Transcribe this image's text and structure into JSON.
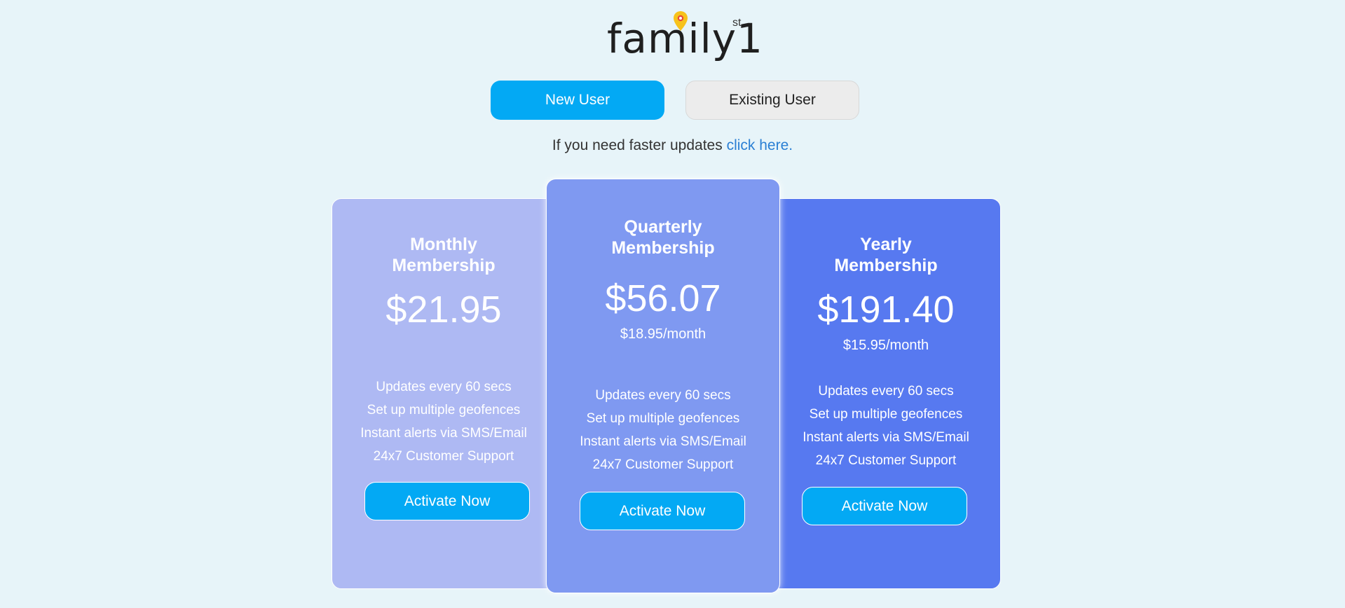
{
  "logo": {
    "word": "family1",
    "superscript": "st",
    "pin_color": "#f7c21b"
  },
  "tabs": {
    "new_user": "New User",
    "existing_user": "Existing User",
    "active": "new_user"
  },
  "notice": {
    "text": "If you need faster updates",
    "link": "click here."
  },
  "colors": {
    "accent": "#03a9f4",
    "background": "#e7f4f9",
    "monthly_card": "#aeb9f3",
    "quarterly_card": "#7f99f1",
    "yearly_card": "#5779f0",
    "link": "#2a7fd4"
  },
  "plans": [
    {
      "title_line1": "Monthly",
      "title_line2": "Membership",
      "price": "$21.95",
      "per_month": "",
      "features": [
        "Updates every 60 secs",
        "Set up multiple geofences",
        "Instant alerts via SMS/Email",
        "24x7 Customer Support"
      ],
      "cta": "Activate Now"
    },
    {
      "title_line1": "Quarterly",
      "title_line2": "Membership",
      "price": "$56.07",
      "per_month": "$18.95/month",
      "features": [
        "Updates every 60 secs",
        "Set up multiple geofences",
        "Instant alerts via SMS/Email",
        "24x7 Customer Support"
      ],
      "cta": "Activate Now"
    },
    {
      "title_line1": "Yearly",
      "title_line2": "Membership",
      "price": "$191.40",
      "per_month": "$15.95/month",
      "features": [
        "Updates every 60 secs",
        "Set up multiple geofences",
        "Instant alerts via SMS/Email",
        "24x7 Customer Support"
      ],
      "cta": "Activate Now"
    }
  ]
}
